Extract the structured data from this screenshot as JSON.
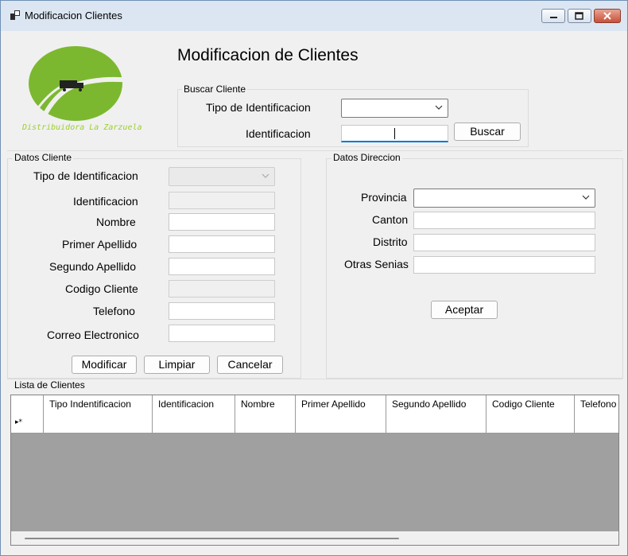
{
  "window": {
    "title": "Modificacion Clientes"
  },
  "header": {
    "title": "Modificacion de Clientes",
    "logo_text": "Distribuidora La Zarzuela"
  },
  "buscar": {
    "legend": "Buscar Cliente",
    "tipo_label": "Tipo de Identificacion",
    "tipo_value": "",
    "id_label": "Identificacion",
    "id_value": "",
    "button": "Buscar"
  },
  "datos_cliente": {
    "legend": "Datos Cliente",
    "fields": {
      "tipo": "Tipo de Identificacion",
      "identificacion": "Identificacion",
      "nombre": "Nombre",
      "primer_apellido": "Primer Apellido",
      "segundo_apellido": "Segundo Apellido",
      "codigo": "Codigo Cliente",
      "telefono": "Telefono",
      "correo": "Correo Electronico"
    },
    "buttons": {
      "modificar": "Modificar",
      "limpiar": "Limpiar",
      "cancelar": "Cancelar"
    }
  },
  "datos_direccion": {
    "legend": "Datos Direccion",
    "fields": {
      "provincia": "Provincia",
      "canton": "Canton",
      "distrito": "Distrito",
      "otras": "Otras Senias"
    },
    "button": "Aceptar"
  },
  "lista": {
    "legend": "Lista de Clientes",
    "columns": [
      "Tipo Indentificacion",
      "Identificacion",
      "Nombre",
      "Primer Apellido",
      "Segundo Apellido",
      "Codigo Cliente",
      "Telefono"
    ],
    "new_row_marker": "▸*"
  },
  "colors": {
    "logo_green": "#7cb82f",
    "logo_text": "#9ad12a",
    "accent": "#0078d7"
  }
}
